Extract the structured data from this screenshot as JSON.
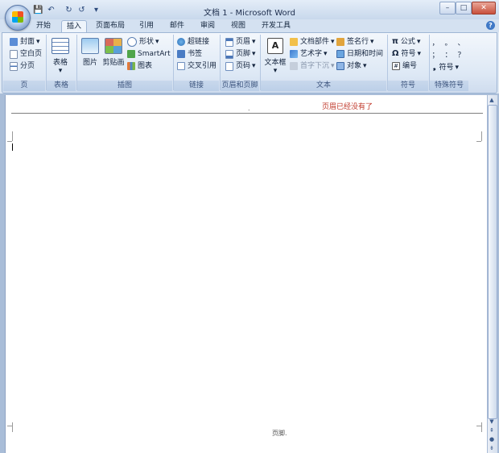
{
  "window": {
    "title": "文档 1 - Microsoft Word"
  },
  "quick_access": {
    "save": "💾",
    "undo": "↶",
    "redo": "↻",
    "customize": "▾"
  },
  "window_controls": {
    "minimize": "–",
    "maximize": "□",
    "close": "✕"
  },
  "tabs": [
    {
      "label": "开始"
    },
    {
      "label": "插入"
    },
    {
      "label": "页面布局"
    },
    {
      "label": "引用"
    },
    {
      "label": "邮件"
    },
    {
      "label": "审阅"
    },
    {
      "label": "视图"
    },
    {
      "label": "开发工具"
    }
  ],
  "active_tab": "插入",
  "help_label": "?",
  "ribbon": {
    "pages": {
      "label": "页",
      "items": [
        "封面",
        "空白页",
        "分页"
      ]
    },
    "tables": {
      "label": "表格",
      "button": "表格"
    },
    "illustrations": {
      "label": "插图",
      "picture": "图片",
      "clipart": "剪贴画",
      "shapes": "形状",
      "smartart": "SmartArt",
      "chart": "图表"
    },
    "links": {
      "label": "链接",
      "hyperlink": "超链接",
      "bookmark": "书签",
      "crossref": "交叉引用"
    },
    "header_footer": {
      "label": "页眉和页脚",
      "header": "页眉",
      "footer": "页脚",
      "page_number": "页码"
    },
    "text": {
      "label": "文本",
      "textbox": "文本框",
      "quickparts": "文档部件",
      "wordart": "艺术字",
      "dropcap": "首字下沉",
      "signature": "签名行",
      "datetime": "日期和时间",
      "object": "对象"
    },
    "symbols": {
      "label": "符号",
      "equation": "公式",
      "symbol": "符号",
      "numbering": "编号"
    },
    "special": {
      "label": "特殊符号",
      "chars": [
        "，",
        "。",
        "、",
        "；",
        "：",
        "？"
      ],
      "symbol": "符号"
    }
  },
  "document": {
    "header_text": "页眉已经没有了",
    "header_marker": ".",
    "footer_label": "页脚."
  },
  "colors": {
    "accent": "#c0392b",
    "ribbon": "#dde8f5",
    "page": "#ffffff"
  }
}
